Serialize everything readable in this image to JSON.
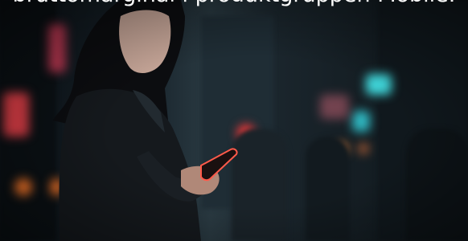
{
  "caption": {
    "text": "bruttomarginal i produktgruppen Mobile."
  },
  "photo": {
    "palette": {
      "background": "#17222a",
      "teal_light": "#3fd4d8",
      "red_light": "#ff3a3a",
      "orange_light": "#ff7a2a",
      "phone_glow": "#ff5a4a"
    }
  }
}
